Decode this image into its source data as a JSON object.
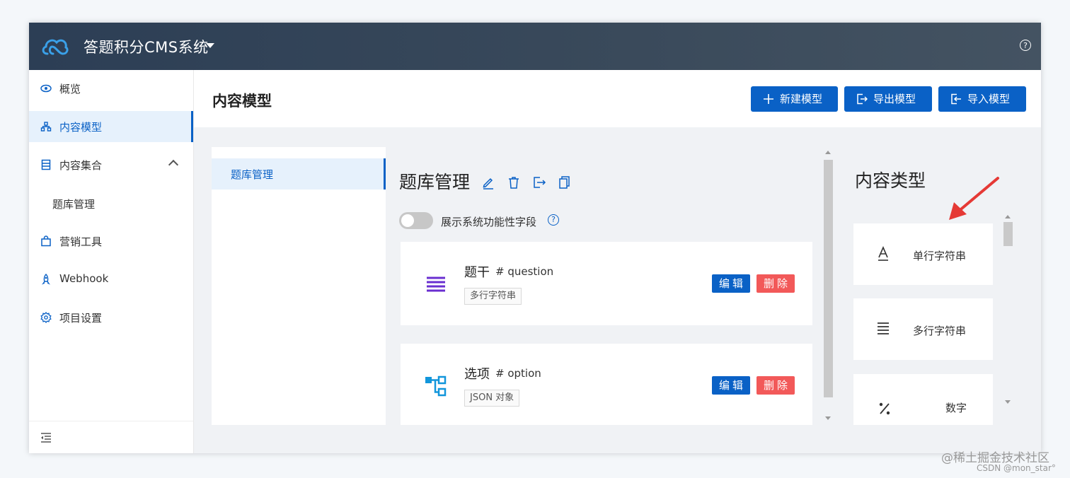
{
  "app": {
    "title": "答题积分CMS系统"
  },
  "sidebar": {
    "items": [
      {
        "label": "概览",
        "icon": "eye-icon"
      },
      {
        "label": "内容模型",
        "icon": "sitemap-icon",
        "active": true
      },
      {
        "label": "内容集合",
        "icon": "database-icon",
        "expanded": true
      },
      {
        "label": "营销工具",
        "icon": "shopping-bag-icon"
      },
      {
        "label": "Webhook",
        "icon": "rocket-icon"
      },
      {
        "label": "项目设置",
        "icon": "gear-icon"
      }
    ],
    "subitems": [
      {
        "label": "题库管理"
      }
    ]
  },
  "header": {
    "title": "内容模型",
    "buttons": [
      {
        "label": "新建模型",
        "icon": "plus-icon"
      },
      {
        "label": "导出模型",
        "icon": "export-icon"
      },
      {
        "label": "导入模型",
        "icon": "import-icon"
      }
    ]
  },
  "models": [
    {
      "label": "题库管理",
      "selected": true
    }
  ],
  "model_detail": {
    "name": "题库管理",
    "toggle_label": "展示系统功能性字段",
    "toggle_on": false,
    "fields": [
      {
        "name": "题干",
        "id": "# question",
        "type": "多行字符串",
        "icon": "multiline-text-icon",
        "icon_color": "#6a2fd0"
      },
      {
        "name": "选项",
        "id": "# option",
        "type": "JSON 对象",
        "icon": "json-tree-icon",
        "icon_color": "#1296db"
      }
    ],
    "edit_label": "编辑",
    "delete_label": "删除"
  },
  "content_types": {
    "title": "内容类型",
    "items": [
      {
        "label": "单行字符串",
        "icon": "single-line-text-icon"
      },
      {
        "label": "多行字符串",
        "icon": "multiline-text-icon"
      },
      {
        "label": "数字",
        "icon": "percent-icon"
      }
    ]
  },
  "watermark": {
    "line1": "@稀土掘金技术社区",
    "line2": "CSDN @mon_star°"
  },
  "colors": {
    "primary": "#0a61c6",
    "danger": "#f25959",
    "topbar": "#2c3e55",
    "annotation": "#e53935"
  }
}
